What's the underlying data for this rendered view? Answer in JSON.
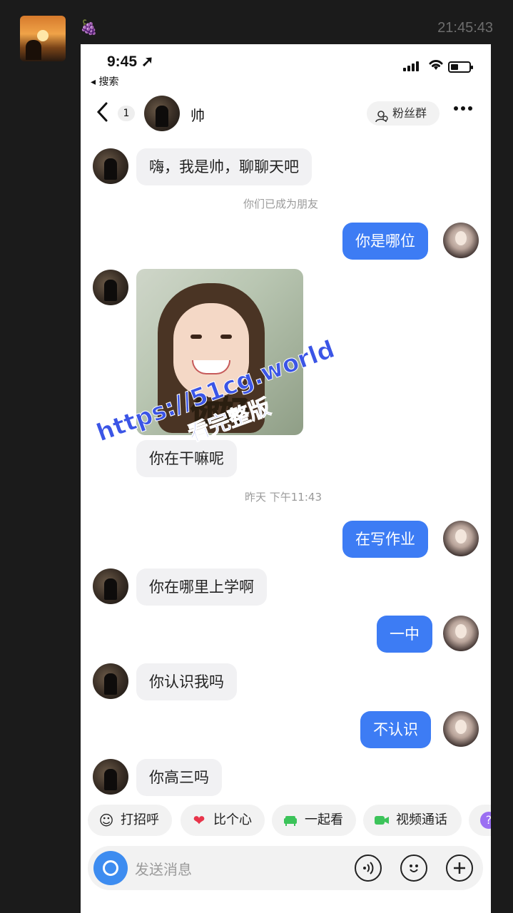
{
  "post": {
    "avatar_icon": "sunset-avatar",
    "name": "🍇",
    "time": "21:45:43"
  },
  "status_bar": {
    "time": "9:45 ➚",
    "back_app": "◂ 搜索"
  },
  "chat_header": {
    "back_icon": "chevron-left-icon",
    "unread_count": "1",
    "contact_name": "帅",
    "fans_group_label": "粉丝群",
    "more_icon": "more-dots-icon"
  },
  "messages": [
    {
      "side": "in",
      "text": "嗨，我是帅，聊聊天吧"
    },
    {
      "side": "system",
      "text": "你们已成为朋友"
    },
    {
      "side": "out",
      "text": "你是哪位"
    },
    {
      "side": "in",
      "type": "sticker",
      "caption": "你好"
    },
    {
      "side": "in",
      "text": "你在干嘛呢"
    },
    {
      "side": "system",
      "text": "昨天 下午11:43"
    },
    {
      "side": "out",
      "text": "在写作业"
    },
    {
      "side": "in",
      "text": "你在哪里上学啊"
    },
    {
      "side": "out",
      "text": "一中"
    },
    {
      "side": "in",
      "text": "你认识我吗"
    },
    {
      "side": "out",
      "text": "不认识"
    },
    {
      "side": "in",
      "text": "你高三吗"
    }
  ],
  "quick_actions": [
    {
      "icon": "wave-hand-icon",
      "label": "打招呼"
    },
    {
      "icon": "heart-icon",
      "label": "比个心"
    },
    {
      "icon": "sofa-icon",
      "label": "一起看"
    },
    {
      "icon": "video-camera-icon",
      "label": "视频通话"
    }
  ],
  "input": {
    "placeholder": "发送消息"
  },
  "watermark": {
    "line1": "https://51cg.world",
    "line2": "看完整版"
  }
}
